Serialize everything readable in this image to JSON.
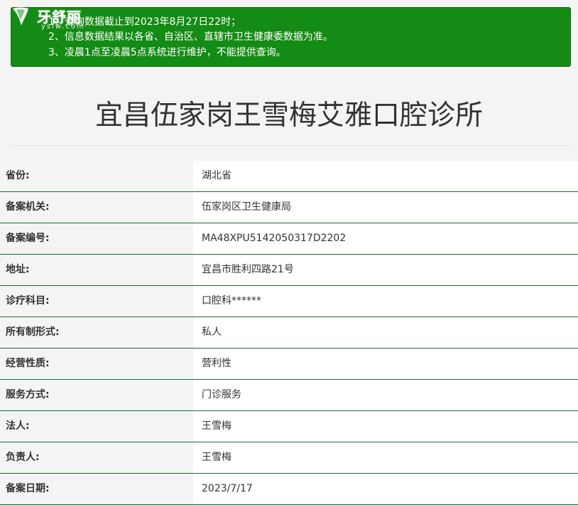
{
  "logo": {
    "brand": "牙舒丽",
    "sub": "yslw.com"
  },
  "notice": {
    "lines": [
      "1、查询数据截止到2023年8月27日22时；",
      "2、信息数据结果以各省、自治区、直辖市卫生健康委数据为准。",
      "3、凌晨1点至凌晨5点系统进行维护，不能提供查询。"
    ]
  },
  "title": "宜昌伍家岗王雪梅艾雅口腔诊所",
  "rows": [
    {
      "label": "省份:",
      "value": "湖北省"
    },
    {
      "label": "备案机关:",
      "value": "伍家岗区卫生健康局"
    },
    {
      "label": "备案编号:",
      "value": "MA48XPU5142050317D2202"
    },
    {
      "label": "地址:",
      "value": "宜昌市胜利四路21号"
    },
    {
      "label": "诊疗科目:",
      "value": "口腔科******"
    },
    {
      "label": "所有制形式:",
      "value": "私人"
    },
    {
      "label": "经营性质:",
      "value": "营利性"
    },
    {
      "label": "服务方式:",
      "value": "门诊服务"
    },
    {
      "label": "法人:",
      "value": "王雪梅"
    },
    {
      "label": "负责人:",
      "value": "王雪梅"
    },
    {
      "label": "备案日期:",
      "value": "2023/7/17"
    }
  ],
  "colors": {
    "notice_bg": "#148b14",
    "row_divider": "#1a6a3a",
    "page_bg": "#f4f4f4"
  }
}
